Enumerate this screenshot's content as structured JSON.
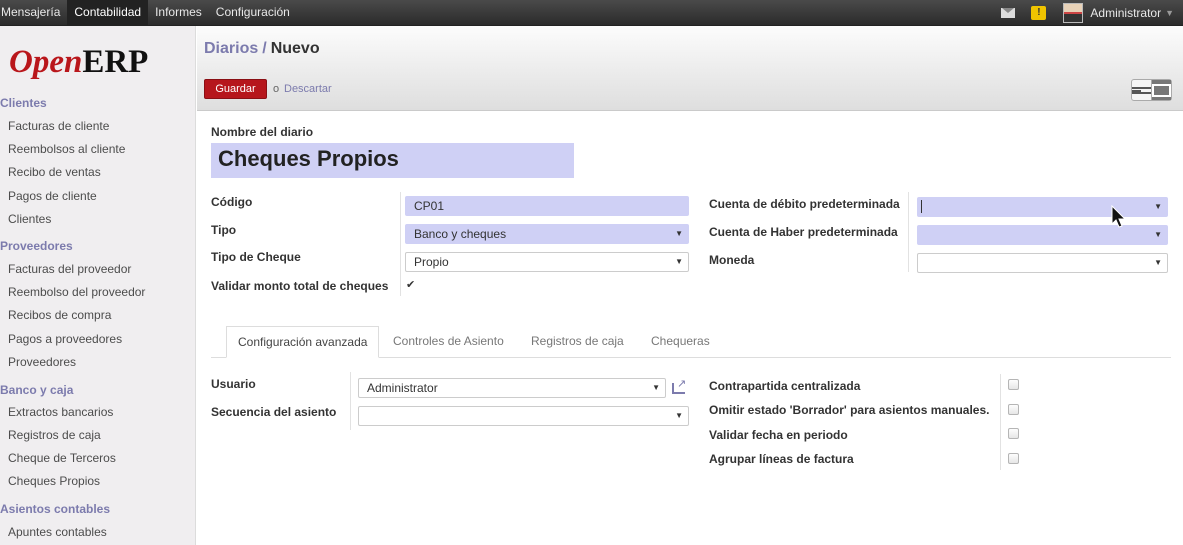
{
  "topbar": {
    "menu": [
      "Mensajería",
      "Contabilidad",
      "Informes",
      "Configuración"
    ],
    "user": "Administrator"
  },
  "logo": {
    "open": "Open",
    "erp": "ERP"
  },
  "sidebar": {
    "groups": [
      {
        "label": "Clientes",
        "items": [
          "Facturas de cliente",
          "Reembolsos al cliente",
          "Recibo de ventas",
          "Pagos de cliente",
          "Clientes"
        ]
      },
      {
        "label": "Proveedores",
        "items": [
          "Facturas del proveedor",
          "Reembolso del proveedor",
          "Recibos de compra",
          "Pagos a proveedores",
          "Proveedores"
        ]
      },
      {
        "label": "Banco y caja",
        "items": [
          "Extractos bancarios",
          "Registros de caja",
          "Cheque de Terceros",
          "Cheques Propios"
        ]
      },
      {
        "label": "Asientos contables",
        "items": [
          "Apuntes contables"
        ]
      }
    ]
  },
  "header": {
    "breadcrumb_parent": "Diarios",
    "breadcrumb_sep": "/",
    "breadcrumb_current": "Nuevo",
    "save_label": "Guardar",
    "or_label": "o",
    "discard_label": "Descartar"
  },
  "form": {
    "name_label": "Nombre del diario",
    "name_value": "Cheques Propios",
    "codigo_label": "Código",
    "codigo_value": "CP01",
    "tipo_label": "Tipo",
    "tipo_value": "Banco y cheques",
    "tipo_cheque_label": "Tipo de Cheque",
    "tipo_cheque_value": "Propio",
    "validar_label": "Validar monto total de cheques",
    "validar_checked": true,
    "debito_label": "Cuenta de débito predeterminada",
    "debito_value": "",
    "haber_label": "Cuenta de Haber predeterminada",
    "haber_value": "",
    "moneda_label": "Moneda",
    "moneda_value": ""
  },
  "tabs": [
    "Configuración avanzada",
    "Controles de Asiento",
    "Registros de caja",
    "Chequeras"
  ],
  "advanced": {
    "usuario_label": "Usuario",
    "usuario_value": "Administrator",
    "secuencia_label": "Secuencia del asiento",
    "secuencia_value": "",
    "checks": [
      {
        "label": "Contrapartida centralizada",
        "checked": false
      },
      {
        "label": "Omitir estado 'Borrador' para asientos manuales.",
        "checked": false
      },
      {
        "label": "Validar fecha en periodo",
        "checked": false
      },
      {
        "label": "Agrupar líneas de factura",
        "checked": false
      }
    ]
  },
  "colors": {
    "accent": "#7c7bad",
    "primary_button": "#b6161c",
    "required_field": "#cfd0f5",
    "topbar": "#333333"
  }
}
